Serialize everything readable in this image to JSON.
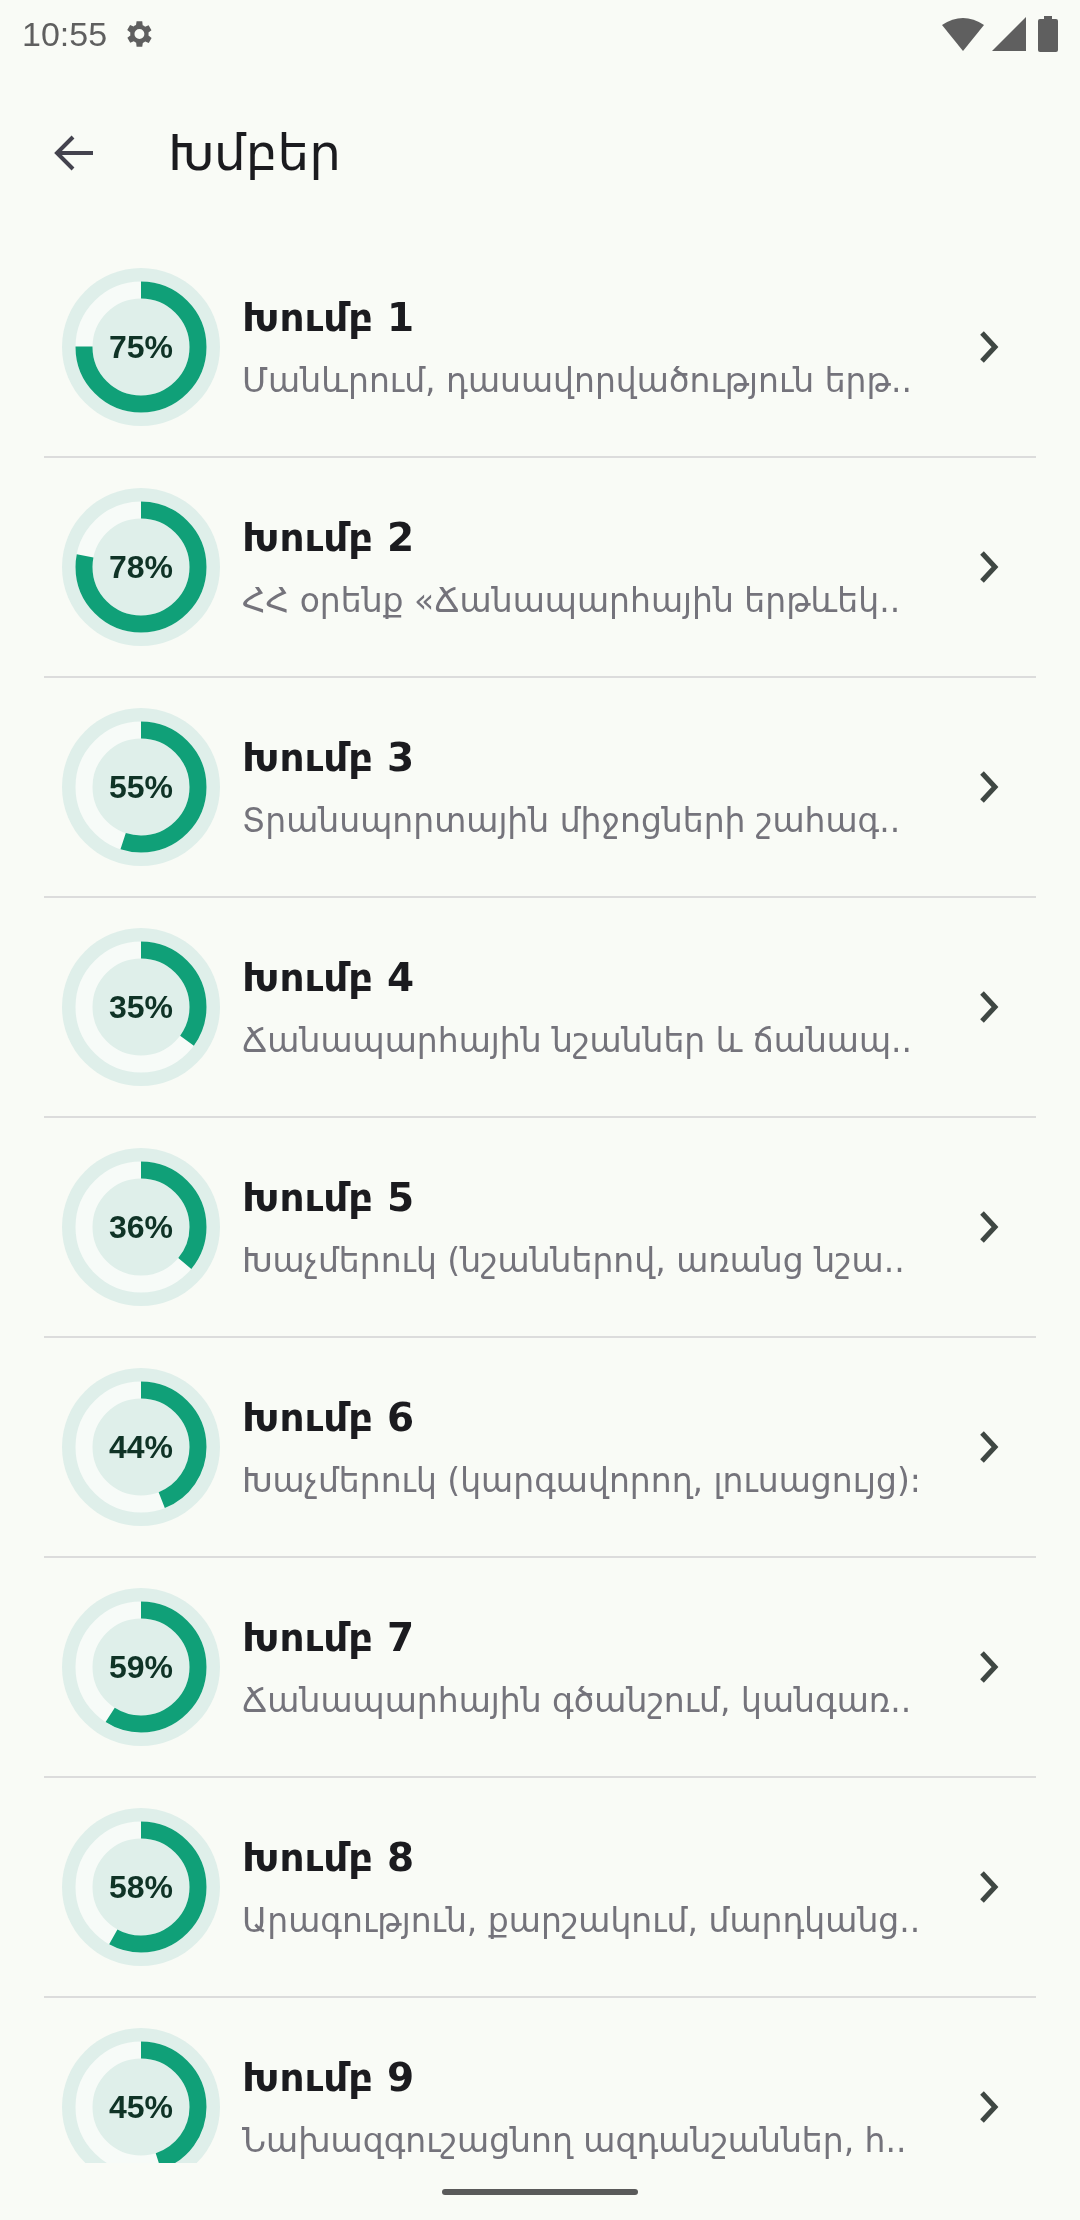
{
  "status_bar": {
    "time": "10:55"
  },
  "app_bar": {
    "title": "Խմբեր"
  },
  "groups": [
    {
      "title": "Խումբ 1",
      "subtitle": "Մանևրում, դասավորվածություն երթ..",
      "percent": "75%",
      "level": 0.75
    },
    {
      "title": "Խումբ 2",
      "subtitle": "ՀՀ օրենք «Ճանապարհային երթևեկ..",
      "percent": "78%",
      "level": 0.78
    },
    {
      "title": "Խումբ 3",
      "subtitle": "Տրանսպորտային միջոցների շահագ..",
      "percent": "55%",
      "level": 0.55
    },
    {
      "title": "Խումբ 4",
      "subtitle": "Ճանապարհային նշաններ և ճանապ..",
      "percent": "35%",
      "level": 0.35
    },
    {
      "title": "Խումբ 5",
      "subtitle": "Խաչմերուկ (նշաններով, առանց նշա..",
      "percent": "36%",
      "level": 0.36
    },
    {
      "title": "Խումբ 6",
      "subtitle": "Խաչմերուկ (կարգավորող, լուսացույց):",
      "percent": "44%",
      "level": 0.44
    },
    {
      "title": "Խումբ 7",
      "subtitle": "Ճանապարհային գծանշում, կանգառ..",
      "percent": "59%",
      "level": 0.59
    },
    {
      "title": "Խումբ 8",
      "subtitle": "Արագություն, քարշակում, մարդկանց..",
      "percent": "58%",
      "level": 0.58
    },
    {
      "title": "Խումբ 9",
      "subtitle": "Նախազգուշացնող ազդանշաններ, հ..",
      "percent": "45%",
      "level": 0.45
    }
  ]
}
